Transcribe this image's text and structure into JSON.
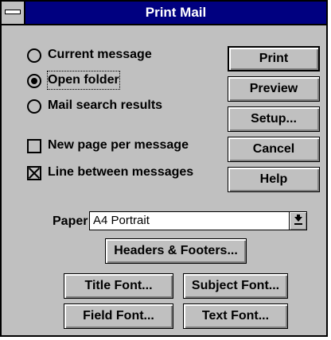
{
  "window": {
    "title": "Print Mail"
  },
  "scope": {
    "options": [
      {
        "label": "Current message",
        "selected": false
      },
      {
        "label": "Open folder",
        "selected": true
      },
      {
        "label": "Mail search results",
        "selected": false
      }
    ]
  },
  "checkboxes": [
    {
      "label": "New page per message",
      "checked": false
    },
    {
      "label": "Line between messages",
      "checked": true
    }
  ],
  "buttons": {
    "print": "Print",
    "preview": "Preview",
    "setup": "Setup...",
    "cancel": "Cancel",
    "help": "Help",
    "headers_footers": "Headers & Footers...",
    "title_font": "Title Font...",
    "subject_font": "Subject Font...",
    "field_font": "Field Font...",
    "text_font": "Text Font..."
  },
  "paper": {
    "label": "Paper",
    "value": "A4 Portrait"
  },
  "icons": {
    "system_menu": "system-menu-icon",
    "dropdown": "dropdown-arrow-icon"
  },
  "colors": {
    "titlebar": "#000080",
    "face": "#c0c0c0"
  }
}
